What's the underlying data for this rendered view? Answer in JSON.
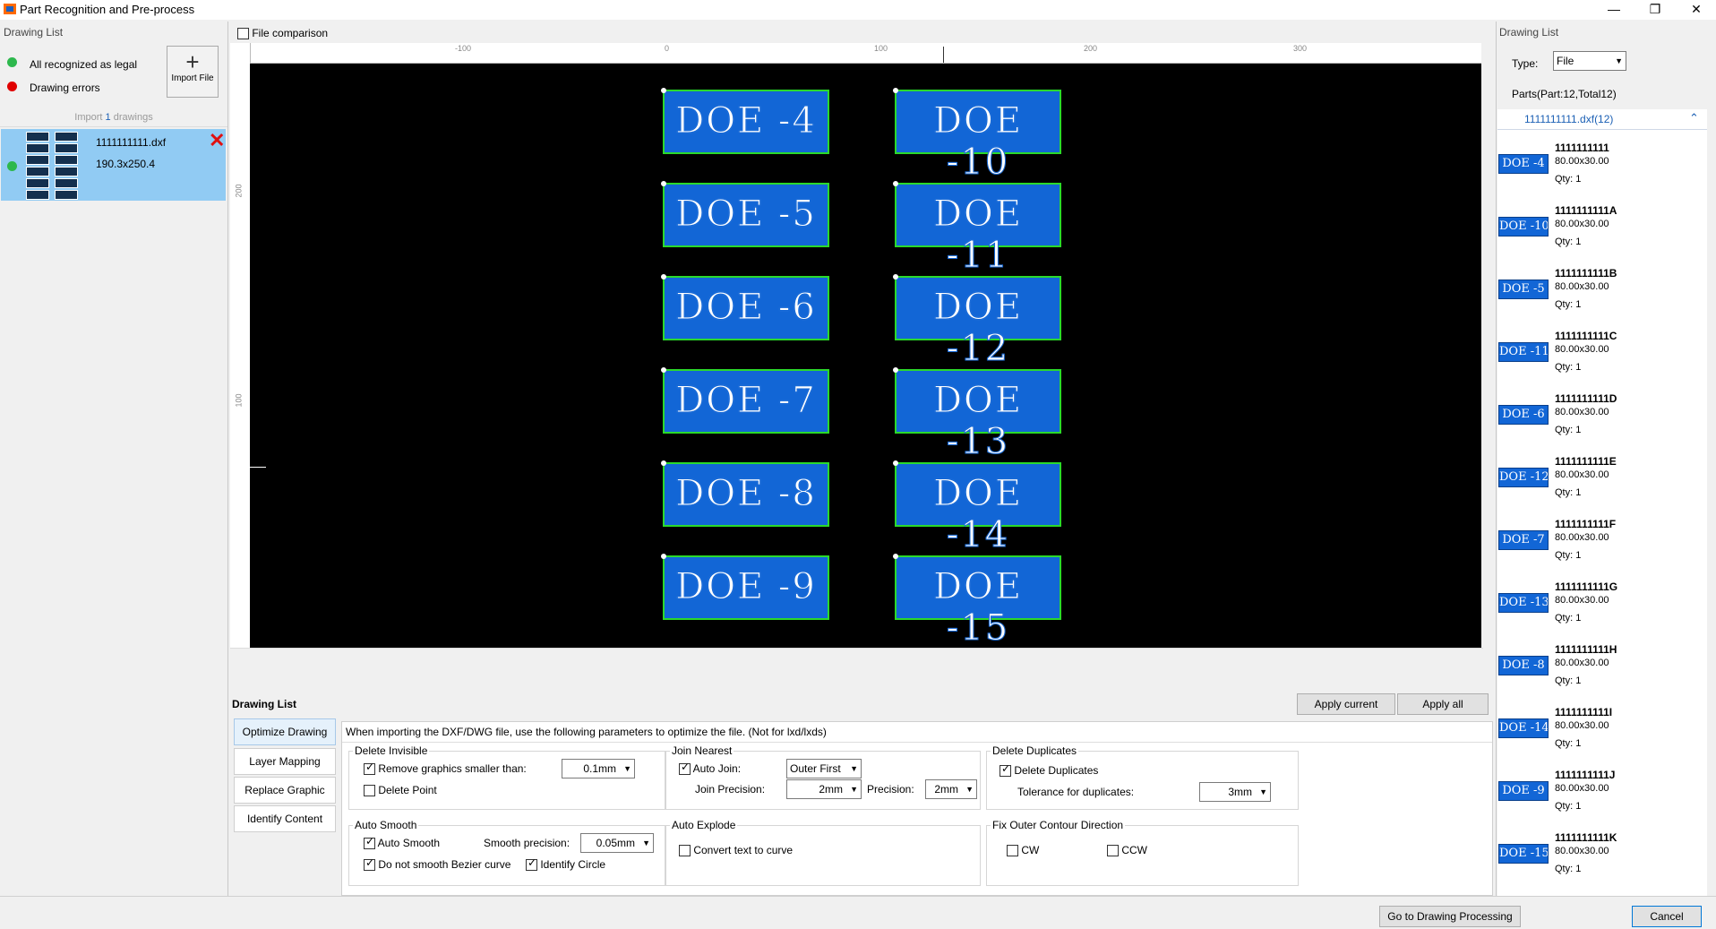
{
  "window": {
    "title": "Part Recognition and Pre-process",
    "minimize_icon": "minimize-icon",
    "restore_icon": "restore-icon",
    "close_icon": "close-icon"
  },
  "left_panel": {
    "title": "Drawing List",
    "legend_legal": "All recognized as legal",
    "legend_errors": "Drawing errors",
    "legal_color": "#2db84d",
    "error_color": "#e00000",
    "import_button_label": "Import File",
    "import_prefix": "Import",
    "import_count": "1",
    "import_suffix": "drawings",
    "file": {
      "name": "1111111111.dxf",
      "size": "190.3x250.4"
    }
  },
  "canvas": {
    "file_comparison_label": "File comparison",
    "ruler_top_labels": [
      "-100",
      "0",
      "100",
      "200",
      "300"
    ],
    "ruler_left_labels": [
      "200",
      "100"
    ],
    "parts": [
      {
        "label": "DOE -4"
      },
      {
        "label": "DOE -10"
      },
      {
        "label": "DOE -5"
      },
      {
        "label": "DOE -11"
      },
      {
        "label": "DOE -6"
      },
      {
        "label": "DOE -12"
      },
      {
        "label": "DOE -7"
      },
      {
        "label": "DOE -13"
      },
      {
        "label": "DOE -8"
      },
      {
        "label": "DOE -14"
      },
      {
        "label": "DOE -9"
      },
      {
        "label": "DOE -15"
      }
    ],
    "part_fill": "#1266d6",
    "part_outline": "#2bd92b"
  },
  "options": {
    "section_title": "Drawing List",
    "apply_current": "Apply current",
    "apply_all": "Apply all",
    "tabs": [
      "Optimize Drawing",
      "Layer Mapping",
      "Replace Graphic",
      "Identify Content"
    ],
    "info_text": "When importing the DXF/DWG file, use the following parameters to optimize the file. (Not for lxd/lxds)",
    "delete_invisible": {
      "title": "Delete Invisible",
      "remove_small_label": "Remove graphics smaller than:",
      "remove_small_value": "0.1mm",
      "delete_point_label": "Delete Point"
    },
    "join_nearest": {
      "title": "Join Nearest",
      "auto_join_label": "Auto Join:",
      "auto_join_value": "Outer First",
      "join_precision_label": "Join Precision:",
      "join_precision_value": "2mm",
      "precision_label": "Precision:",
      "precision_value": "2mm"
    },
    "delete_duplicates": {
      "title": "Delete Duplicates",
      "delete_label": "Delete Duplicates",
      "tolerance_label": "Tolerance for duplicates:",
      "tolerance_value": "3mm"
    },
    "auto_smooth": {
      "title": "Auto Smooth",
      "auto_smooth_label": "Auto Smooth",
      "smooth_precision_label": "Smooth precision:",
      "smooth_precision_value": "0.05mm",
      "no_bezier_label": "Do not smooth Bezier curve",
      "identify_circle_label": "Identify Circle"
    },
    "auto_explode": {
      "title": "Auto Explode",
      "convert_text_label": "Convert text to curve"
    },
    "fix_outer": {
      "title": "Fix Outer Contour Direction",
      "cw_label": "CW",
      "ccw_label": "CCW"
    }
  },
  "right_panel": {
    "title": "Drawing List",
    "type_label": "Type:",
    "type_value": "File",
    "parts_summary": "Parts(Part:12,Total12)",
    "tree_file": "1111111111.dxf(12)",
    "parts": [
      {
        "name": "1111111111",
        "size": "80.00x30.00",
        "qty": "Qty: 1",
        "thumb": "DOE -4"
      },
      {
        "name": "1111111111A",
        "size": "80.00x30.00",
        "qty": "Qty: 1",
        "thumb": "DOE -10"
      },
      {
        "name": "1111111111B",
        "size": "80.00x30.00",
        "qty": "Qty: 1",
        "thumb": "DOE -5"
      },
      {
        "name": "1111111111C",
        "size": "80.00x30.00",
        "qty": "Qty: 1",
        "thumb": "DOE -11"
      },
      {
        "name": "1111111111D",
        "size": "80.00x30.00",
        "qty": "Qty: 1",
        "thumb": "DOE -6"
      },
      {
        "name": "1111111111E",
        "size": "80.00x30.00",
        "qty": "Qty: 1",
        "thumb": "DOE -12"
      },
      {
        "name": "1111111111F",
        "size": "80.00x30.00",
        "qty": "Qty: 1",
        "thumb": "DOE -7"
      },
      {
        "name": "1111111111G",
        "size": "80.00x30.00",
        "qty": "Qty: 1",
        "thumb": "DOE -13"
      },
      {
        "name": "1111111111H",
        "size": "80.00x30.00",
        "qty": "Qty: 1",
        "thumb": "DOE -8"
      },
      {
        "name": "1111111111I",
        "size": "80.00x30.00",
        "qty": "Qty: 1",
        "thumb": "DOE -14"
      },
      {
        "name": "1111111111J",
        "size": "80.00x30.00",
        "qty": "Qty: 1",
        "thumb": "DOE -9"
      },
      {
        "name": "1111111111K",
        "size": "80.00x30.00",
        "qty": "Qty: 1",
        "thumb": "DOE -15"
      }
    ]
  },
  "footer": {
    "go_button": "Go to Drawing Processing",
    "cancel_button": "Cancel"
  }
}
